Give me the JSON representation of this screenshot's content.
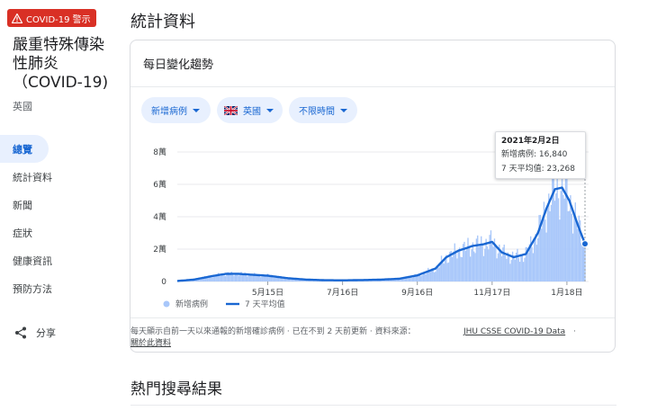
{
  "alert": {
    "label": "COVID-19 警示",
    "color": "#d93025",
    "icon": "warning-triangle-icon"
  },
  "sidebar": {
    "disease_title": "嚴重特殊傳染性肺炎（COVID-19)",
    "country": "英國",
    "items": [
      {
        "label": "總覽",
        "active": true
      },
      {
        "label": "統計資料",
        "active": false
      },
      {
        "label": "新聞",
        "active": false
      },
      {
        "label": "症狀",
        "active": false
      },
      {
        "label": "健康資訊",
        "active": false
      },
      {
        "label": "預防方法",
        "active": false
      }
    ],
    "share_label": "分享",
    "share_icon": "share-icon"
  },
  "main": {
    "section_title": "統計資料",
    "card_title": "每日變化趨勢",
    "filters": {
      "metric": "新增病例",
      "country": "英國",
      "country_flag": "uk-flag-icon",
      "time_range": "不限時間"
    },
    "legend": {
      "bars": "新增病例",
      "line": "7 天平均值"
    },
    "tooltip": {
      "date": "2021年2月2日",
      "new_cases_label": "新增病例",
      "new_cases_value": "16,840",
      "avg_label": "7 天平均值",
      "avg_value": "23,268"
    },
    "footer": {
      "note_line1": "每天顯示自前一天以來通報的新增確診病例 · 已在不到 2 天前更新 · 資料來源：",
      "source_link": "JHU CSSE COVID-19 Data",
      "source_suffix": " ·",
      "about_link": "關於此資料"
    },
    "hot_searches_title": "熱門搜尋結果"
  },
  "colors": {
    "accent": "#1a73e8",
    "bar": "#a8c7fa",
    "line": "#1967d2",
    "chip_bg": "#e8f0fe"
  },
  "chart_data": {
    "type": "bar",
    "ylim": [
      0,
      80000
    ],
    "y_ticks": [
      0,
      20000,
      40000,
      60000,
      80000
    ],
    "y_tick_labels": [
      "0",
      "2萬",
      "4萬",
      "6萬",
      "8萬"
    ],
    "x_tick_labels": [
      "5月15日",
      "7月16日",
      "9月16日",
      "11月17日",
      "1月18日"
    ],
    "series": [
      {
        "name": "新增病例",
        "kind": "bar"
      },
      {
        "name": "7 天平均值",
        "kind": "line"
      }
    ],
    "x": [
      "2020-03-01",
      "2020-03-15",
      "2020-03-31",
      "2020-04-10",
      "2020-04-20",
      "2020-05-01",
      "2020-05-15",
      "2020-06-01",
      "2020-06-15",
      "2020-07-01",
      "2020-07-16",
      "2020-08-01",
      "2020-08-15",
      "2020-09-01",
      "2020-09-16",
      "2020-10-01",
      "2020-10-10",
      "2020-10-20",
      "2020-11-01",
      "2020-11-10",
      "2020-11-17",
      "2020-11-25",
      "2020-12-05",
      "2020-12-15",
      "2020-12-25",
      "2021-01-01",
      "2021-01-08",
      "2021-01-14",
      "2021-01-20",
      "2021-01-27",
      "2021-02-02"
    ],
    "values_7day_avg": [
      300,
      1200,
      3500,
      4700,
      4800,
      4200,
      3600,
      2000,
      1200,
      800,
      700,
      900,
      1100,
      1700,
      3800,
      8000,
      15000,
      19000,
      22000,
      23000,
      24500,
      18000,
      15000,
      17000,
      30000,
      45000,
      57000,
      58000,
      50000,
      35000,
      23268
    ],
    "highlight": {
      "date": "2021年2月2日",
      "new_cases": 16840,
      "avg": 23268
    }
  }
}
